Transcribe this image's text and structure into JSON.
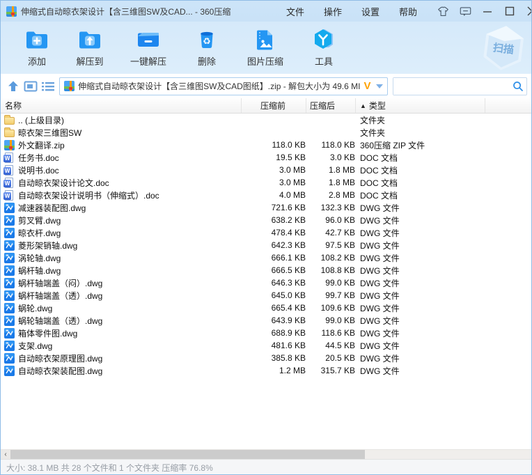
{
  "window": {
    "title": "伸缩式自动晾衣架设计【含三维图SW及CAD... - 360压缩"
  },
  "menu": {
    "items": [
      "文件",
      "操作",
      "设置",
      "帮助"
    ]
  },
  "toolbar": {
    "buttons": [
      {
        "label": "添加",
        "icon": "add-archive-icon"
      },
      {
        "label": "解压到",
        "icon": "extract-to-icon"
      },
      {
        "label": "一键解压",
        "icon": "one-click-extract-icon"
      },
      {
        "label": "删除",
        "icon": "delete-icon"
      },
      {
        "label": "图片压缩",
        "icon": "image-compress-icon"
      },
      {
        "label": "工具",
        "icon": "tools-icon"
      }
    ],
    "scan_badge_label": "扫描"
  },
  "addressbar": {
    "archive_label": "伸缩式自动晾衣架设计【含三维图SW及CAD图纸】.zip - 解包大小为 49.6 MI",
    "v_logo": "V",
    "search_value": "",
    "search_placeholder": ""
  },
  "list": {
    "columns": [
      {
        "label": "名称"
      },
      {
        "label": "压缩前"
      },
      {
        "label": "压缩后"
      },
      {
        "label": "类型",
        "sort_indicator": "▲"
      }
    ],
    "rows": [
      {
        "icon": "folder",
        "name": ".. (上级目录)",
        "size_before": "",
        "size_after": "",
        "type": "文件夹"
      },
      {
        "icon": "folder",
        "name": "晾衣架三维图SW",
        "size_before": "",
        "size_after": "",
        "type": "文件夹"
      },
      {
        "icon": "zip",
        "name": "外文翻译.zip",
        "size_before": "118.0 KB",
        "size_after": "118.0 KB",
        "type": "360压缩 ZIP 文件"
      },
      {
        "icon": "doc",
        "name": "任务书.doc",
        "size_before": "19.5 KB",
        "size_after": "3.0 KB",
        "type": "DOC 文档"
      },
      {
        "icon": "doc",
        "name": "说明书.doc",
        "size_before": "3.0 MB",
        "size_after": "1.8 MB",
        "type": "DOC 文档"
      },
      {
        "icon": "doc",
        "name": "自动晾衣架设计论文.doc",
        "size_before": "3.0 MB",
        "size_after": "1.8 MB",
        "type": "DOC 文档"
      },
      {
        "icon": "doc",
        "name": "自动晾衣架设计说明书（伸缩式）.doc",
        "size_before": "4.0 MB",
        "size_after": "2.8 MB",
        "type": "DOC 文档"
      },
      {
        "icon": "dwg",
        "name": "减速器装配图.dwg",
        "size_before": "721.6 KB",
        "size_after": "132.3 KB",
        "type": "DWG 文件"
      },
      {
        "icon": "dwg",
        "name": "剪叉臂.dwg",
        "size_before": "638.2 KB",
        "size_after": "96.0 KB",
        "type": "DWG 文件"
      },
      {
        "icon": "dwg",
        "name": "晾衣杆.dwg",
        "size_before": "478.4 KB",
        "size_after": "42.7 KB",
        "type": "DWG 文件"
      },
      {
        "icon": "dwg",
        "name": "菱形架销轴.dwg",
        "size_before": "642.3 KB",
        "size_after": "97.5 KB",
        "type": "DWG 文件"
      },
      {
        "icon": "dwg",
        "name": "涡轮轴.dwg",
        "size_before": "666.1 KB",
        "size_after": "108.2 KB",
        "type": "DWG 文件"
      },
      {
        "icon": "dwg",
        "name": "蜗杆轴.dwg",
        "size_before": "666.5 KB",
        "size_after": "108.8 KB",
        "type": "DWG 文件"
      },
      {
        "icon": "dwg",
        "name": "蜗杆轴端盖（闷）.dwg",
        "size_before": "646.3 KB",
        "size_after": "99.0 KB",
        "type": "DWG 文件"
      },
      {
        "icon": "dwg",
        "name": "蜗杆轴端盖（透）.dwg",
        "size_before": "645.0 KB",
        "size_after": "99.7 KB",
        "type": "DWG 文件"
      },
      {
        "icon": "dwg",
        "name": "蜗轮.dwg",
        "size_before": "665.4 KB",
        "size_after": "109.6 KB",
        "type": "DWG 文件"
      },
      {
        "icon": "dwg",
        "name": "蜗轮轴端盖（透）.dwg",
        "size_before": "643.9 KB",
        "size_after": "99.0 KB",
        "type": "DWG 文件"
      },
      {
        "icon": "dwg",
        "name": "箱体零件图.dwg",
        "size_before": "688.9 KB",
        "size_after": "118.6 KB",
        "type": "DWG 文件"
      },
      {
        "icon": "dwg",
        "name": "支架.dwg",
        "size_before": "481.6 KB",
        "size_after": "44.5 KB",
        "type": "DWG 文件"
      },
      {
        "icon": "dwg",
        "name": "自动晾衣架原理图.dwg",
        "size_before": "385.8 KB",
        "size_after": "20.5 KB",
        "type": "DWG 文件"
      },
      {
        "icon": "dwg",
        "name": "自动晾衣架装配图.dwg",
        "size_before": "1.2 MB",
        "size_after": "315.7 KB",
        "type": "DWG 文件"
      }
    ]
  },
  "statusbar": {
    "text": "大小: 38.1 MB 共 28 个文件和 1 个文件夹 压缩率 76.8%"
  },
  "colors": {
    "accent_blue": "#2496f3",
    "titlebar_bg": "#cde4f8",
    "folder_yellow": "#f2cd6e",
    "orange_v": "#ffa200",
    "status_text": "#979da5"
  }
}
